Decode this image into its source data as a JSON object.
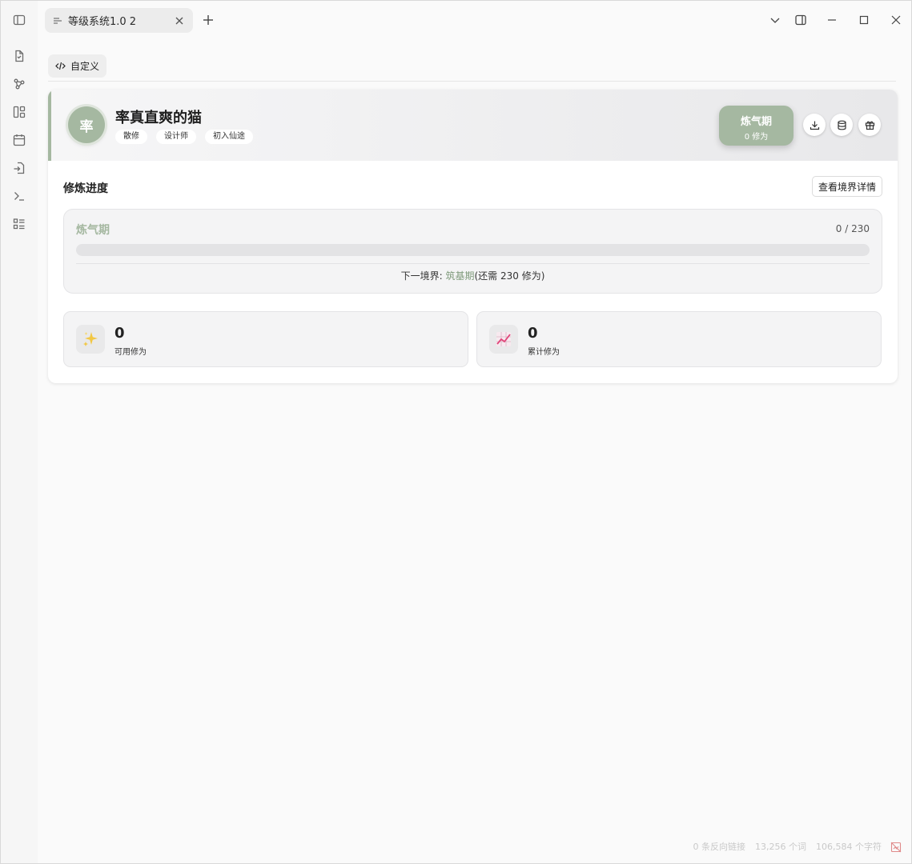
{
  "titlebar": {
    "tab_title": "等级系统1.0 2",
    "icons": [
      "sidebar-toggle-icon",
      "tab-list-icon",
      "close-icon",
      "plus-icon",
      "chevron-down-icon",
      "right-sidebar-icon",
      "minimize-icon",
      "maximize-icon",
      "window-close-icon"
    ]
  },
  "ribbon": {
    "icons": [
      "file-icon",
      "graph-icon",
      "canvas-icon",
      "calendar-icon",
      "import-icon",
      "terminal-icon",
      "list-icon"
    ]
  },
  "view": {
    "custom_label": "自定义"
  },
  "profile": {
    "avatar_char": "率",
    "name": "率真直爽的猫",
    "tags": [
      "散修",
      "设计师",
      "初入仙途"
    ],
    "realm": "炼气期",
    "realm_points": "0 修为"
  },
  "progress": {
    "section_title": "修炼进度",
    "detail_button": "查看境界详情",
    "realm": "炼气期",
    "count": "0 / 230",
    "fraction": 0,
    "next_prefix": "下一境界: ",
    "next_realm": "筑基期",
    "next_suffix": "(还需 230 修为)"
  },
  "stats": [
    {
      "value": "0",
      "label": "可用修为",
      "icon": "sparkles-icon"
    },
    {
      "value": "0",
      "label": "累计修为",
      "icon": "chart-up-icon"
    }
  ],
  "statusbar": {
    "backlinks": "0 条反向链接",
    "words": "13,256 个词",
    "chars": "106,584 个字符"
  },
  "colors": {
    "accent": "#a5b8a1",
    "accent_text": "#7f9a7b"
  }
}
